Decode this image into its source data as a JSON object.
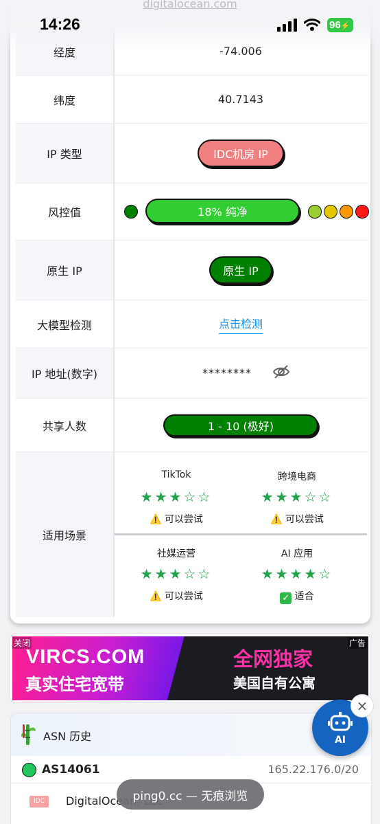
{
  "top_link": "digitalocean.com",
  "status_bar": {
    "time": "14:26",
    "battery": "96",
    "signal_icon": "cellular-signal-icon",
    "wifi_icon": "wifi-icon"
  },
  "rows": {
    "longitude": {
      "label": "经度",
      "value": "-74.006"
    },
    "latitude": {
      "label": "纬度",
      "value": "40.7143"
    },
    "ip_type": {
      "label": "IP 类型",
      "value": "IDC机房 IP",
      "color": "#f08080"
    },
    "risk": {
      "label": "风控值",
      "value": "18%  纯净",
      "level": 0.18,
      "colors": [
        "#008000",
        "#32cd32",
        "#9acd32",
        "#e6c800",
        "#ff9800",
        "#ff1a1a"
      ]
    },
    "native": {
      "label": "原生 IP",
      "value": "原生 IP",
      "color": "#008000"
    },
    "llm": {
      "label": "大模型检测",
      "value": "点击检测"
    },
    "ip_numeric": {
      "label": "IP 地址(数字)",
      "value": "********",
      "icon": "eye-off-icon"
    },
    "shared": {
      "label": "共享人数",
      "value": "1 - 10 (极好)",
      "color": "#008000"
    },
    "scenarios": {
      "label": "适用场景",
      "items": [
        {
          "name": "TikTok",
          "stars": "★★★☆☆",
          "rating": 3,
          "status_icon": "warning-icon",
          "status": "可以尝试"
        },
        {
          "name": "跨境电商",
          "stars": "★★★☆☆",
          "rating": 3,
          "status_icon": "warning-icon",
          "status": "可以尝试"
        },
        {
          "name": "社媒运营",
          "stars": "★★★☆☆",
          "rating": 3,
          "status_icon": "warning-icon",
          "status": "可以尝试"
        },
        {
          "name": "AI 应用",
          "stars": "★★★★☆",
          "rating": 4,
          "status_icon": "check-icon",
          "status": "适合"
        }
      ]
    }
  },
  "ad": {
    "close": "关闭",
    "tag": "广告",
    "line1_left": "VIRCS.COM",
    "line1_right": "全网独家",
    "line2_left": "真实住宅宽带",
    "line2_right": "美国自有公寓"
  },
  "asn": {
    "title": "ASN 历史",
    "number": "AS14061",
    "prefix": "165.22.176.0/20",
    "badge": "IDC",
    "org": "DigitalOcean, LLC"
  },
  "ai_button": {
    "label": "AI",
    "close": "×"
  },
  "toast": "ping0.cc — 无痕浏览"
}
